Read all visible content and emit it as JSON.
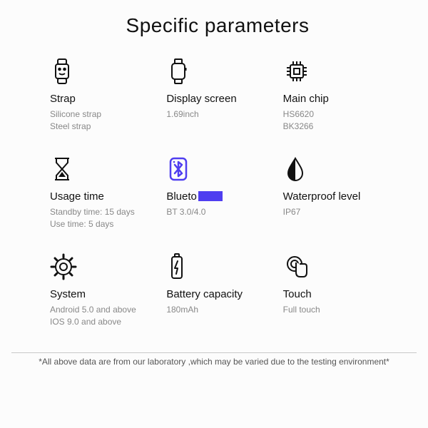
{
  "title": "Specific parameters",
  "items": [
    {
      "label": "Strap",
      "desc": "Silicone strap\nSteel strap"
    },
    {
      "label": "Display screen",
      "desc": "1.69inch"
    },
    {
      "label": "Main chip",
      "desc": "HS6620\nBK3266"
    },
    {
      "label": "Usage time",
      "desc": "Standby time: 15 days\nUse time: 5 days"
    },
    {
      "label": "Blueto",
      "desc": "BT 3.0/4.0"
    },
    {
      "label": "Waterproof level",
      "desc": "IP67"
    },
    {
      "label": "System",
      "desc": "Android 5.0 and above\nIOS 9.0 and above"
    },
    {
      "label": "Battery capacity",
      "desc": "180mAh"
    },
    {
      "label": "Touch",
      "desc": "Full touch"
    }
  ],
  "footnote": "*All above data are from our laboratory ,which may be varied due to the testing environment*"
}
